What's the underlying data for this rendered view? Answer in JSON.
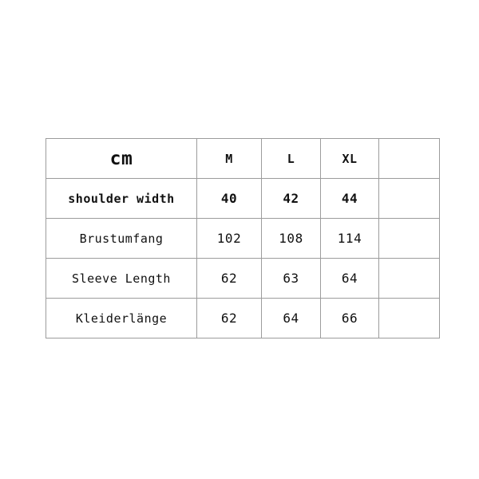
{
  "page": {
    "background_color": "#ffffff",
    "border_color": "#9c9c9c",
    "text_color": "#111111"
  },
  "table": {
    "name": "size-chart",
    "units_label": "cm",
    "columns": [
      "cm",
      "M",
      "L",
      "XL",
      ""
    ],
    "rows": [
      {
        "label": "cm",
        "emphasis": "header",
        "values": [
          "M",
          "L",
          "XL",
          ""
        ]
      },
      {
        "label": "shoulder width",
        "emphasis": "bold",
        "values": [
          "40",
          "42",
          "44",
          ""
        ]
      },
      {
        "label": "Brustumfang",
        "emphasis": "normal",
        "values": [
          "102",
          "108",
          "114",
          ""
        ]
      },
      {
        "label": "Sleeve Length",
        "emphasis": "normal",
        "values": [
          "62",
          "63",
          "64",
          ""
        ]
      },
      {
        "label": "Kleiderlänge",
        "emphasis": "normal",
        "values": [
          "62",
          "64",
          "66",
          ""
        ]
      }
    ]
  },
  "chart_data": {
    "type": "table",
    "title": "",
    "unit": "cm",
    "categories": [
      "M",
      "L",
      "XL"
    ],
    "series": [
      {
        "name": "shoulder width",
        "values": [
          40,
          42,
          44
        ]
      },
      {
        "name": "Brustumfang",
        "values": [
          102,
          108,
          114
        ]
      },
      {
        "name": "Sleeve Length",
        "values": [
          62,
          63,
          64
        ]
      },
      {
        "name": "Kleiderlänge",
        "values": [
          62,
          64,
          66
        ]
      }
    ],
    "xlabel": "",
    "ylabel": "",
    "grid": true,
    "legend": "none"
  }
}
